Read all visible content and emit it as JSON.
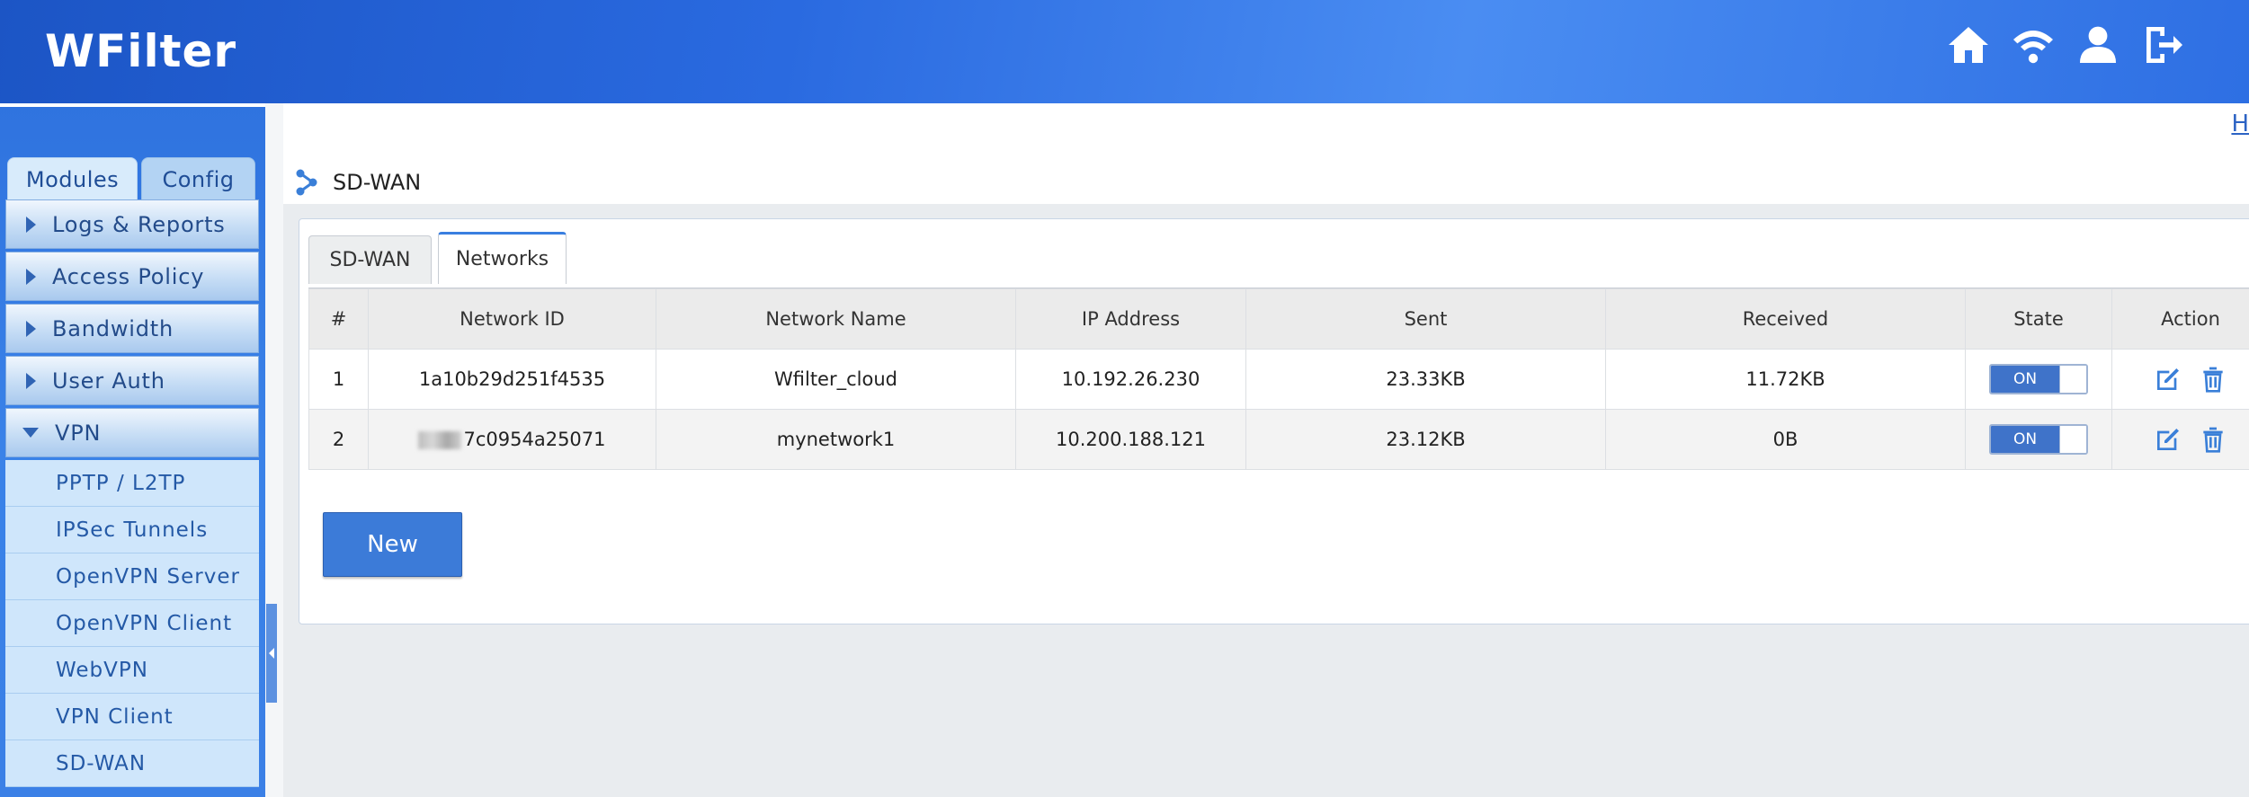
{
  "app": {
    "logo": "WFilter"
  },
  "header": {
    "icons": [
      "home-icon",
      "wifi-icon",
      "user-icon",
      "logout-icon"
    ]
  },
  "sidebar": {
    "tabs": [
      {
        "label": "Modules"
      },
      {
        "label": "Config"
      }
    ],
    "items": [
      {
        "label": "Logs & Reports",
        "expanded": false
      },
      {
        "label": "Access Policy",
        "expanded": false
      },
      {
        "label": "Bandwidth",
        "expanded": false
      },
      {
        "label": "User Auth",
        "expanded": false
      },
      {
        "label": "VPN",
        "expanded": true
      }
    ],
    "vpn_sub": [
      {
        "label": "PPTP / L2TP"
      },
      {
        "label": "IPSec Tunnels"
      },
      {
        "label": "OpenVPN Server"
      },
      {
        "label": "OpenVPN Client"
      },
      {
        "label": "WebVPN"
      },
      {
        "label": "VPN Client"
      },
      {
        "label": "SD-WAN"
      }
    ]
  },
  "main": {
    "top_link": "H",
    "breadcrumb": "SD-WAN",
    "tabs": [
      {
        "label": "SD-WAN"
      },
      {
        "label": "Networks"
      }
    ],
    "table": {
      "headers": [
        "#",
        "Network  ID",
        "Network  Name",
        "IP  Address",
        "Sent",
        "Received",
        "State",
        "Action"
      ],
      "rows": [
        {
          "num": "1",
          "network_id": "1a10b29d251f4535",
          "network_name": "Wfilter_cloud",
          "ip": "10.192.26.230",
          "sent": "23.33KB",
          "received": "11.72KB",
          "state": "ON"
        },
        {
          "num": "2",
          "network_id": "7c0954a25071",
          "network_name": "mynetwork1",
          "ip": "10.200.188.121",
          "sent": "23.12KB",
          "received": "0B",
          "state": "ON"
        }
      ]
    },
    "new_button": "New"
  },
  "colors": {
    "header_blue": "#2a6ae0",
    "button_blue": "#3c7bd8",
    "toggle_on": "#3f73c9"
  }
}
